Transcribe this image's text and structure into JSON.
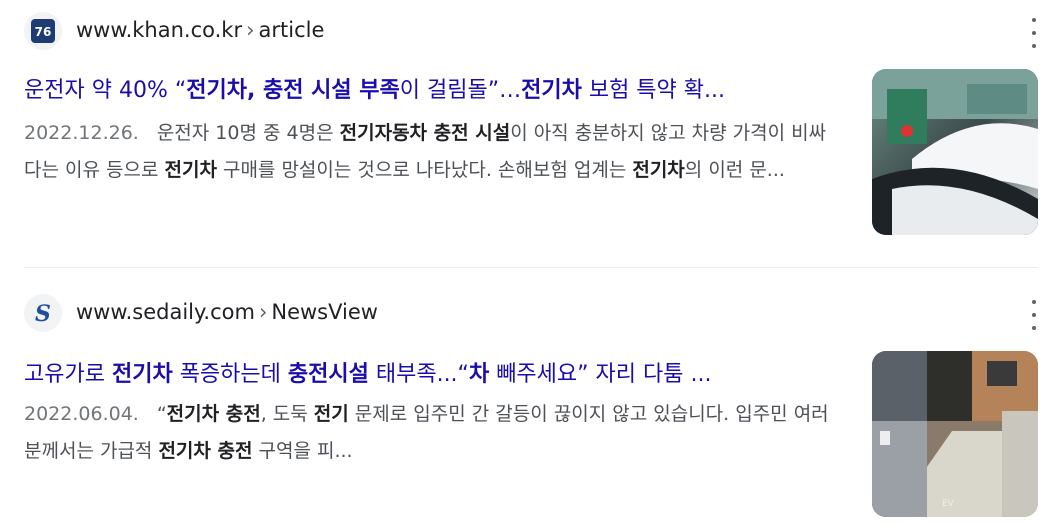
{
  "results": [
    {
      "domain": "www.khan.co.kr",
      "path": "article",
      "favicon_icon": "khan-logo-icon",
      "title_parts": [
        {
          "t": "운전자 약 40% “",
          "b": false
        },
        {
          "t": "전기차, 충전 시설 부족",
          "b": true
        },
        {
          "t": "이 걸림돌”…",
          "b": false
        },
        {
          "t": "전기차",
          "b": true
        },
        {
          "t": " 보험 특약 확...",
          "b": false
        }
      ],
      "date": "2022.12.26.",
      "snippet_parts": [
        {
          "t": "운전자 10명 중 4명은 ",
          "b": false
        },
        {
          "t": "전기자동차 충전 시설",
          "b": true
        },
        {
          "t": "이 아직 충분하지 않고 차량 가격이 비싸다는 이유 등으로 ",
          "b": false
        },
        {
          "t": "전기차",
          "b": true
        },
        {
          "t": " 구매를 망설이는 것으로 나타났다. 손해보험 업계는 ",
          "b": false
        },
        {
          "t": "전기차",
          "b": true
        },
        {
          "t": "의 이런 문...",
          "b": false
        }
      ],
      "thumbnail": "ev-charging-station-photo"
    },
    {
      "domain": "www.sedaily.com",
      "path": "NewsView",
      "favicon_icon": "sedaily-logo-icon",
      "title_parts": [
        {
          "t": "고유가로 ",
          "b": false
        },
        {
          "t": "전기차",
          "b": true
        },
        {
          "t": " 폭증하는데 ",
          "b": false
        },
        {
          "t": "충전시설",
          "b": true
        },
        {
          "t": " 태부족...“",
          "b": false
        },
        {
          "t": "차",
          "b": true
        },
        {
          "t": " 빼주세요” 자리 다툼 ...",
          "b": false
        }
      ],
      "date": "2022.06.04.",
      "snippet_parts": [
        {
          "t": "“",
          "b": false
        },
        {
          "t": "전기차 충전",
          "b": true
        },
        {
          "t": ", 도둑 ",
          "b": false
        },
        {
          "t": "전기",
          "b": true
        },
        {
          "t": " 문제로 입주민 간 갈등이 끊이지 않고 있습니다. 입주민 여러분께서는 가급적 ",
          "b": false
        },
        {
          "t": "전기차 충전",
          "b": true
        },
        {
          "t": " 구역을 피...",
          "b": false
        }
      ],
      "thumbnail": "parking-lot-ev-photo"
    }
  ],
  "colors": {
    "link": "#1a0dab",
    "snippet": "#4d5156",
    "date": "#70757a"
  },
  "kebab_icon": "more-vert-icon"
}
